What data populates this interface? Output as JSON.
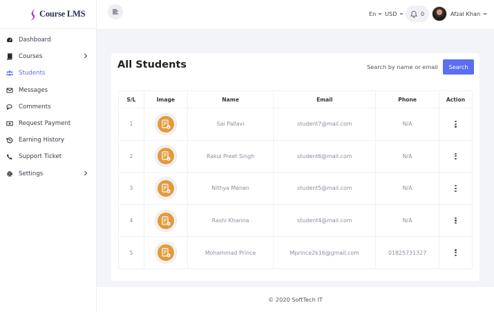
{
  "brand": {
    "name": "Course LMS",
    "colors": {
      "accent": "#5a6ff2",
      "logo_gradient": [
        "#6a4ff0",
        "#e04ca8"
      ]
    }
  },
  "sidebar": {
    "items": [
      {
        "label": "Dashboard",
        "icon": "tachometer-icon",
        "active": false,
        "has_arrow": false
      },
      {
        "label": "Courses",
        "icon": "book-icon",
        "active": false,
        "has_arrow": true
      },
      {
        "label": "Students",
        "icon": "users-icon",
        "active": true,
        "has_arrow": false
      },
      {
        "label": "Messages",
        "icon": "envelope-icon",
        "active": false,
        "has_arrow": false
      },
      {
        "label": "Comments",
        "icon": "comments-icon",
        "active": false,
        "has_arrow": false
      },
      {
        "label": "Request Payment",
        "icon": "money-bill-icon",
        "active": false,
        "has_arrow": false
      },
      {
        "label": "Earning History",
        "icon": "history-icon",
        "active": false,
        "has_arrow": false
      },
      {
        "label": "Support Ticket",
        "icon": "phone-icon",
        "active": false,
        "has_arrow": false
      },
      {
        "label": "Settings",
        "icon": "gear-icon",
        "active": false,
        "has_arrow": true
      }
    ]
  },
  "topbar": {
    "language": "En",
    "currency": "USD",
    "notifications_count": "0",
    "user_name": "Afzal Khan"
  },
  "main": {
    "title": "All Students",
    "search": {
      "placeholder": "Search by name or email",
      "button_label": "Search"
    },
    "table": {
      "headers": [
        "S/L",
        "Image",
        "Name",
        "Email",
        "Phone",
        "Action"
      ],
      "rows": [
        {
          "sl": "1",
          "name": "Sai Pallavi",
          "email": "student7@mail.com",
          "phone": "N/A"
        },
        {
          "sl": "2",
          "name": "Rakul Preet Singh",
          "email": "student6@mail.com",
          "phone": "N/A"
        },
        {
          "sl": "3",
          "name": "Nithya Menen",
          "email": "student5@mail.com",
          "phone": "N/A"
        },
        {
          "sl": "4",
          "name": "Rashi Khanna",
          "email": "student4@mail.com",
          "phone": "N/A"
        },
        {
          "sl": "5",
          "name": "Mohammad Prince",
          "email": "Mprince2k16@gmail.com",
          "phone": "01825731327"
        }
      ]
    }
  },
  "footer": {
    "text": "© 2020 SoftTech IT"
  }
}
